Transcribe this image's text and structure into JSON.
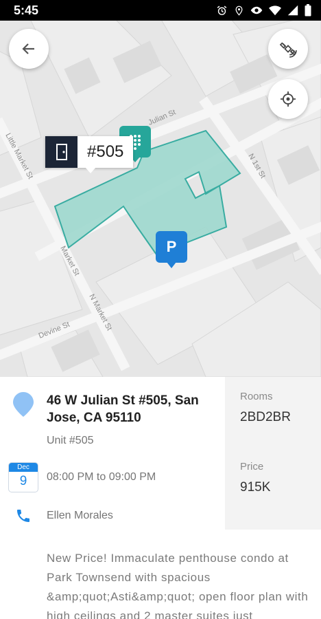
{
  "status_bar": {
    "time": "5:45",
    "icons": [
      "alarm-icon",
      "location-icon",
      "eye-icon",
      "wifi-icon",
      "signal-icon",
      "battery-icon"
    ]
  },
  "map": {
    "street_labels": [
      "Julian St",
      "Little Market St",
      "N 1st St",
      "Market St",
      "N Market St",
      "Devine St"
    ],
    "unit_callout_label": "#505",
    "parking_pin_label": "P",
    "building_color": "#9fd9cf"
  },
  "details": {
    "address": "46 W Julian St #505, San Jose, CA 95110",
    "unit": "Unit  #505",
    "calendar": {
      "month": "Dec",
      "day": "9"
    },
    "time_range": "08:00 PM to 09:00 PM",
    "contact_name": "Ellen Morales",
    "rooms_label": "Rooms",
    "rooms_value": "2BD2BR",
    "price_label": "Price",
    "price_value": "915K",
    "description": "New Price! Immaculate penthouse condo at Park Townsend with spacious &amp;quot;Asti&amp;quot; open floor plan with high ceilings and 2 master suites just"
  },
  "colors": {
    "accent_blue": "#1e88e5",
    "teal": "#26a69a",
    "navy": "#1c2536"
  }
}
